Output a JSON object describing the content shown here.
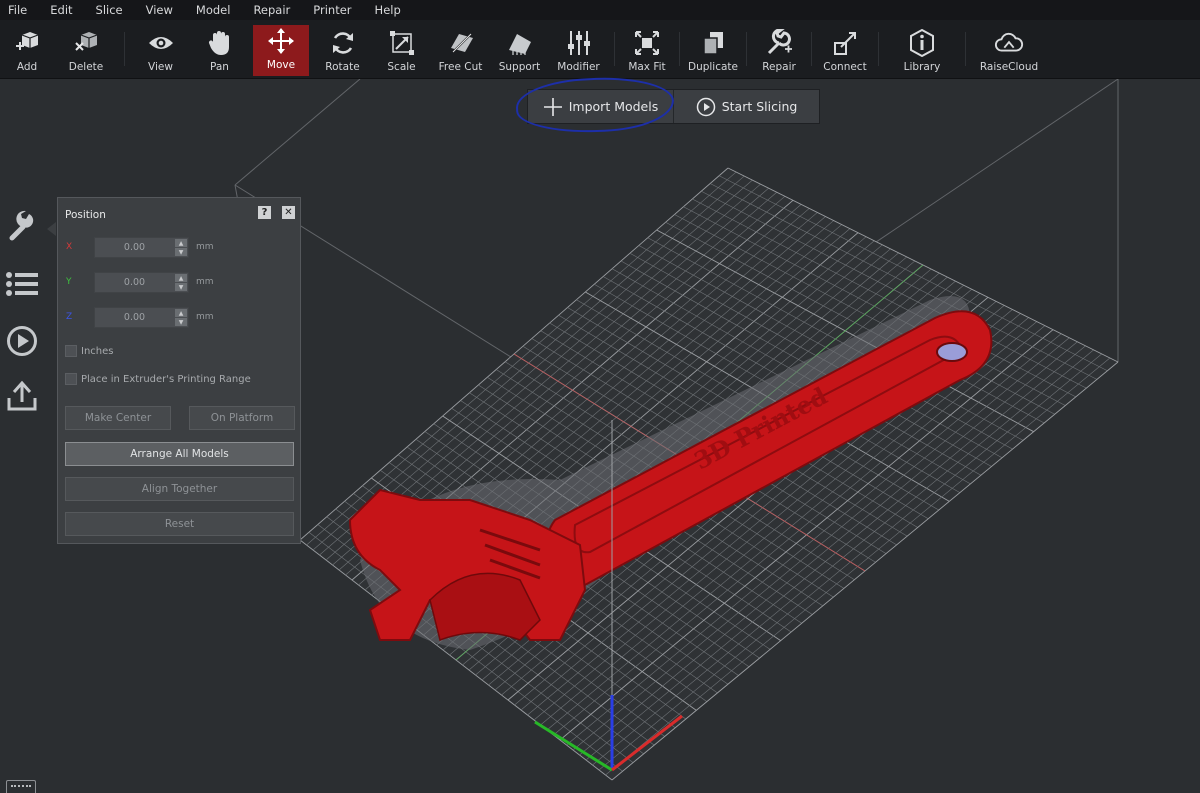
{
  "menu": [
    "File",
    "Edit",
    "Slice",
    "View",
    "Model",
    "Repair",
    "Printer",
    "Help"
  ],
  "toolbar": [
    {
      "label": "Add",
      "icon": "add-cube-icon"
    },
    {
      "label": "Delete",
      "icon": "delete-cube-icon"
    },
    {
      "label": "View",
      "icon": "eye-icon"
    },
    {
      "label": "Pan",
      "icon": "hand-icon"
    },
    {
      "label": "Move",
      "icon": "move-arrows-icon",
      "active": true
    },
    {
      "label": "Rotate",
      "icon": "rotate-icon"
    },
    {
      "label": "Scale",
      "icon": "scale-icon"
    },
    {
      "label": "Free Cut",
      "icon": "free-cut-icon"
    },
    {
      "label": "Support",
      "icon": "support-icon"
    },
    {
      "label": "Modifier",
      "icon": "modifier-sliders-icon"
    },
    {
      "label": "Max Fit",
      "icon": "max-fit-icon"
    },
    {
      "label": "Duplicate",
      "icon": "duplicate-icon"
    },
    {
      "label": "Repair",
      "icon": "wrench-plus-icon"
    },
    {
      "label": "Connect",
      "icon": "connect-icon"
    },
    {
      "label": "Library",
      "icon": "info-shield-icon"
    },
    {
      "label": "RaiseCloud",
      "icon": "cloud-icon"
    }
  ],
  "actions": {
    "import": "Import Models",
    "slice": "Start Slicing"
  },
  "panel": {
    "title": "Position",
    "help": "?",
    "close": "✕",
    "x_label": "X",
    "y_label": "Y",
    "z_label": "Z",
    "x_value": "0.00",
    "y_value": "0.00",
    "z_value": "0.00",
    "unit": "mm",
    "inches": "Inches",
    "place_in_range": "Place in Extruder's Printing Range",
    "make_center": "Make Center",
    "on_platform": "On Platform",
    "arrange_all": "Arrange All Models",
    "align_together": "Align Together",
    "reset": "Reset"
  },
  "model": {
    "text": "3D Printed"
  },
  "colors": {
    "accent": "#8d1a1c",
    "model": "#c61418",
    "annotation": "#1d2fa9",
    "axis_x": "#d92b2b",
    "axis_y": "#27b827",
    "axis_z": "#2a3ee6"
  }
}
